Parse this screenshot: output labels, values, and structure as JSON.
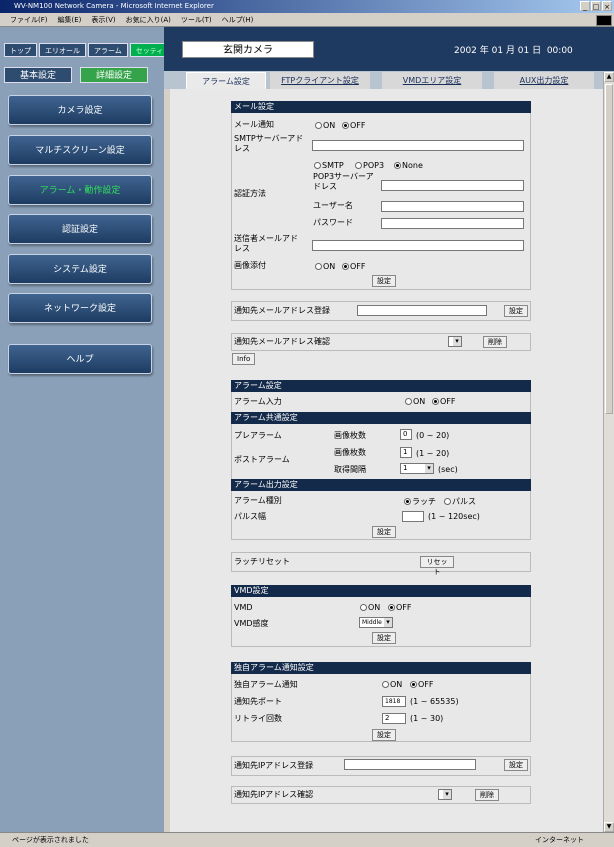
{
  "window": {
    "title": "WV-NM100 Network Camera - Microsoft Internet Explorer"
  },
  "menu": [
    "ファイル(F)",
    "編集(E)",
    "表示(V)",
    "お気に入り(A)",
    "ツール(T)",
    "ヘルプ(H)"
  ],
  "topnav": [
    "トップ",
    "エリオール",
    "アラーム",
    "セッティング"
  ],
  "subnav": [
    "基本設定",
    "詳細設定"
  ],
  "sidebar": [
    "カメラ設定",
    "マルチスクリーン設定",
    "アラーム・動作設定",
    "認証設定",
    "システム設定",
    "ネットワーク設定",
    "ヘルプ"
  ],
  "header": {
    "camera": "玄関カメラ",
    "datetime": "2002 年 01 月 01 日  00:00"
  },
  "tabs": [
    "アラーム設定",
    "FTPクライアント設定",
    "VMDエリア設定",
    "AUX出力設定"
  ],
  "mail": {
    "head": "メール設定",
    "notify_label": "メール通知",
    "smtp_label": "SMTPサーバーアドレス",
    "auth_label": "認証方法",
    "auth_opts": [
      "SMTP",
      "POP3",
      "None"
    ],
    "pop3_label": "POP3サーバーアドレス",
    "user_label": "ユーザー名",
    "pass_label": "パスワード",
    "sender_label": "送信者メールアドレス",
    "attach_label": "画像添付",
    "set": "設定"
  },
  "on": "ON",
  "off": "OFF",
  "dest": {
    "reg_label": "通知先メールアドレス登録",
    "set": "設定",
    "confirm_label": "通知先メールアドレス確認",
    "delete": "削除",
    "info": "Info"
  },
  "alarm": {
    "head": "アラーム設定",
    "input_label": "アラーム入力",
    "common_head": "アラーム共通設定",
    "pre_label": "プレアラーム",
    "post_label": "ポストアラーム",
    "img_count": "画像枚数",
    "interval": "取得間隔",
    "pre_value": "0",
    "pre_range": "(0 ~ 20)",
    "post_value": "1",
    "post_range": "(1 ~ 20)",
    "interval_value": "1",
    "interval_unit": "(sec)",
    "out_head": "アラーム出力設定",
    "type_label": "アラーム種別",
    "type_opts": [
      "ラッチ",
      "パルス"
    ],
    "pulse_label": "パルス幅",
    "pulse_range": "(1 ~ 120sec)",
    "set": "設定"
  },
  "latch": {
    "label": "ラッチリセット",
    "button": "リセット"
  },
  "vmd": {
    "head": "VMD設定",
    "vmd_label": "VMD",
    "sens_label": "VMD感度",
    "sens_value": "Middle",
    "set": "設定"
  },
  "own": {
    "head": "独自アラーム通知設定",
    "notify_label": "独自アラーム通知",
    "port_label": "通知先ポート",
    "port_value": "1818",
    "port_range": "(1 ~ 65535)",
    "retry_label": "リトライ回数",
    "retry_value": "2",
    "retry_range": "(1 ~ 30)",
    "set": "設定"
  },
  "ipdest": {
    "reg_label": "通知先IPアドレス登録",
    "set": "設定",
    "confirm_label": "通知先IPアドレス確認",
    "delete": "削除"
  },
  "status": {
    "text": "ページが表示されました",
    "zone": "インターネット"
  }
}
